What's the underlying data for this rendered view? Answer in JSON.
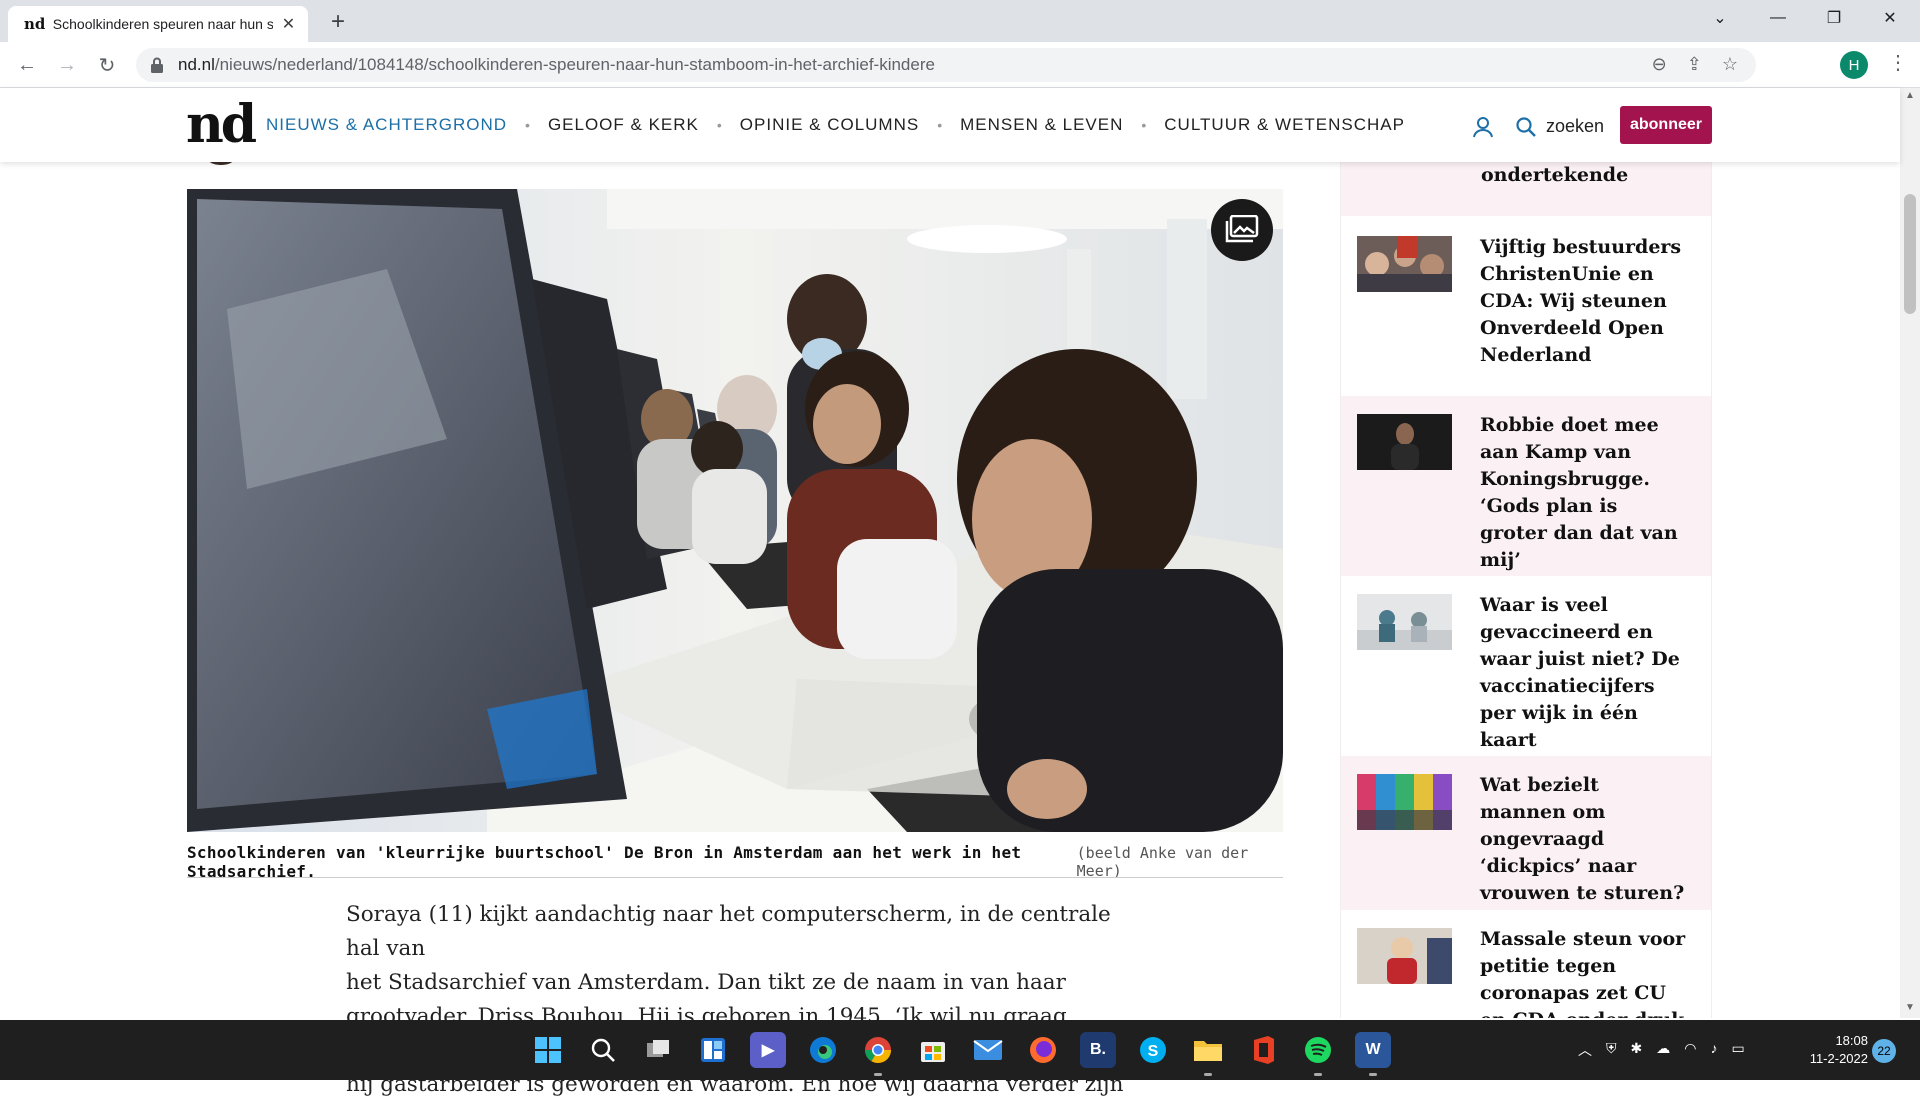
{
  "browser": {
    "tab_favicon": "nd",
    "tab_title": "Schoolkinderen speuren naar hun stamboom",
    "new_tab": "+",
    "url_host": "nd.nl",
    "url_path": "/nieuws/nederland/1084148/schoolkinderen-speuren-naar-hun-stamboom-in-het-archief-kindere",
    "profile_initial": "H"
  },
  "site": {
    "logo": "nd",
    "nav": [
      {
        "label": "NIEUWS & ACHTERGROND",
        "active": true
      },
      {
        "label": "GELOOF & KERK"
      },
      {
        "label": "OPINIE & COLUMNS"
      },
      {
        "label": "MENSEN & LEVEN"
      },
      {
        "label": "CULTUUR & WETENSCHAP"
      }
    ],
    "search_label": "zoeken",
    "subscribe_label": "abonneer"
  },
  "article": {
    "caption": "Schoolkinderen van 'kleurrijke buurtschool' De Bron in Amsterdam aan het werk in het Stadsarchief.",
    "credit": "(beeld Anke van der Meer)",
    "body_lines": [
      "Soraya (11) kijkt aandachtig naar het computerscherm, in de centrale hal van",
      "het Stadsarchief van Amsterdam. Dan tikt ze de naam in van haar",
      "grootvader, Driss Bouhou. Hij is geboren in 1945. ‘Ik wil nu graag weten hoe",
      "hij gastarbeider is geworden en waarom. En hoe wij daarna verder zijn"
    ]
  },
  "sidebar": {
    "top_partial": "ondertekende",
    "items": [
      {
        "title": "Vijftig bestuurders ChristenUnie en CDA: Wij steunen Onverdeeld Open Nederland",
        "pink": false
      },
      {
        "title": "Robbie doet mee aan Kamp van Koningsbrugge. ‘Gods plan is groter dan dat van mij’",
        "pink": true
      },
      {
        "title": "Waar is veel gevaccineerd en waar juist niet? De vaccinatiecijfers per wijk in één kaart",
        "pink": false
      },
      {
        "title": "Wat bezielt mannen om ongevraagd ‘dickpics’ naar vrouwen te sturen?",
        "pink": true
      },
      {
        "title": "Massale steun voor petitie tegen coronapas zet CU en CDA onder druk",
        "pink": false
      }
    ]
  },
  "taskbar": {
    "time": "18:08",
    "date": "11-2-2022",
    "notifications": "22",
    "apps": [
      "start-icon",
      "search-icon",
      "task-view-icon",
      "widgets-icon",
      "teams-icon",
      "edge-icon",
      "chrome-icon",
      "store-icon",
      "mail-icon",
      "firefox-icon",
      "b-icon",
      "skype-icon",
      "explorer-icon",
      "office-icon",
      "spotify-icon",
      "word-icon"
    ]
  },
  "colors": {
    "accent": "#a3134e",
    "nav_active": "#1d6fa8",
    "sidebar_pink": "#fbf1f4"
  }
}
